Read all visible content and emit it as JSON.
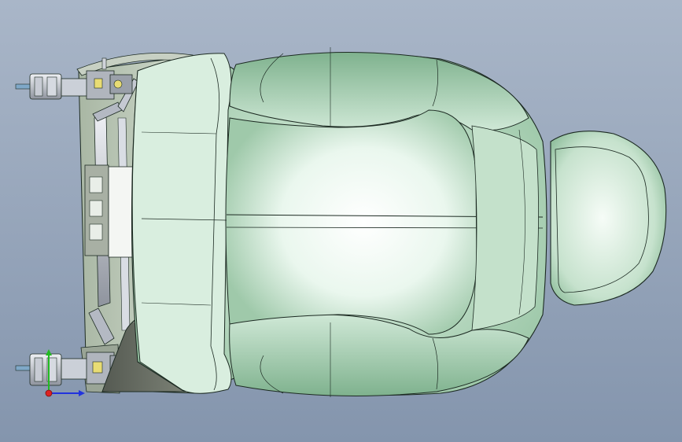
{
  "viewport": {
    "background_top": "#a9b6c8",
    "background_bottom": "#8495ad"
  },
  "model": {
    "surface_color": "#cfe8d6",
    "edge_color": "#1c2a22",
    "frame_color": "#b8c2b0",
    "mechanism_color": "#8f949e",
    "accent_color": "#e8dc74"
  },
  "triad": {
    "x_axis_color": "#2233dd",
    "y_axis_color": "#22bb22",
    "z_axis_color": "#dd2222",
    "icon": "coordinate-triad-icon"
  }
}
